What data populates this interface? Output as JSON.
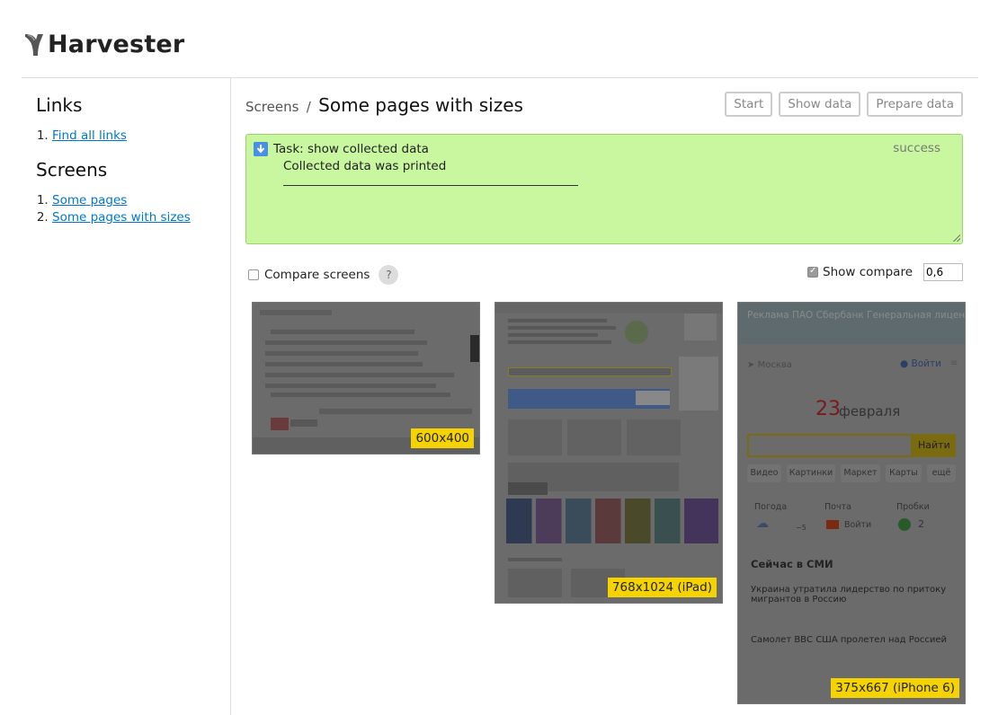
{
  "app": {
    "title": "Harvester"
  },
  "sidebar": {
    "links_heading": "Links",
    "links": [
      {
        "label": "Find all links"
      }
    ],
    "screens_heading": "Screens",
    "screens": [
      {
        "label": "Some pages"
      },
      {
        "label": "Some pages with sizes"
      }
    ]
  },
  "breadcrumb": {
    "parent": "Screens",
    "separator": "/",
    "current": "Some pages with sizes"
  },
  "toolbar": {
    "start": "Start",
    "show_data": "Show data",
    "prepare_data": "Prepare data"
  },
  "task": {
    "title": "Task: show collected data",
    "status": "success",
    "message": "Collected data was printed"
  },
  "options": {
    "compare_screens": "Compare screens",
    "help": "?",
    "show_compare": "Show compare",
    "compare_value": "0,6"
  },
  "screens": [
    {
      "size": "600x400"
    },
    {
      "size": "768x1024 (iPad)"
    },
    {
      "size": "375x667 (iPhone 6)"
    }
  ],
  "mobile_preview": {
    "top_ad": "Реклама  ПАО  Сбербанк  Генеральная  лицензия",
    "location": "Москва",
    "login": "Войти",
    "date_num": "23",
    "date_word": "февраля",
    "search_button": "Найти",
    "tabs": [
      "Видео",
      "Картинки",
      "Маркет",
      "Карты",
      "ещё"
    ],
    "widgets": [
      "Погода",
      "Почта",
      "Пробки"
    ],
    "weather_value": "−5",
    "mail_login": "Войти",
    "traffic_value": "2",
    "news_heading": "Сейчас в СМИ",
    "news": [
      "Украина утратила лидерство по притоку мигрантов в Россию",
      "Самолет ВВС США пролетел над Россией"
    ]
  },
  "colors": {
    "accent": "#0077cc",
    "success_bg": "#c9f7a0",
    "label_bg": "#f5d300"
  }
}
